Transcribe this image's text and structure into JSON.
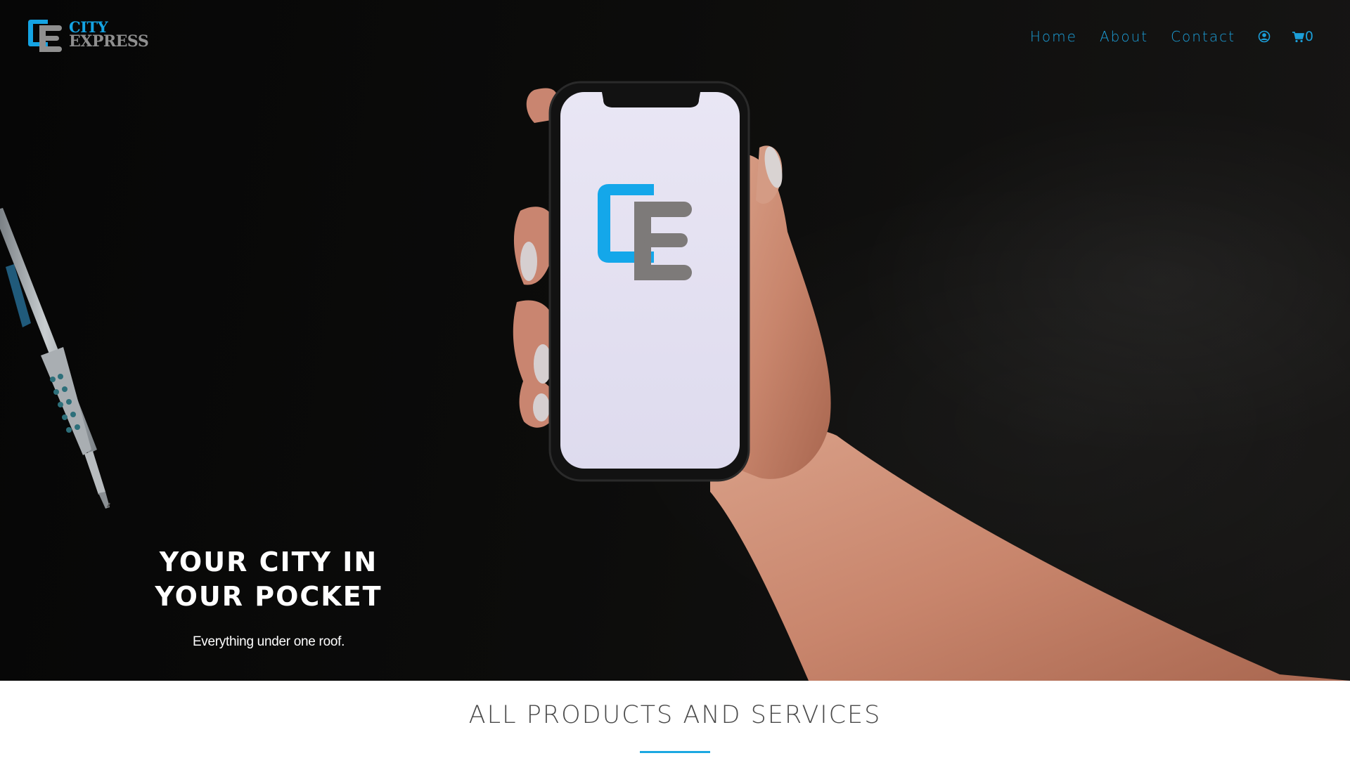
{
  "header": {
    "logo": {
      "line1": "CITY",
      "line2": "EXPRESS"
    },
    "nav": [
      {
        "label": "Home"
      },
      {
        "label": "About"
      },
      {
        "label": "Contact"
      }
    ],
    "account_icon": "user-circle-icon",
    "cart_icon": "shopping-cart-icon",
    "cart_count": "0"
  },
  "hero": {
    "title_line1": "YOUR CITY IN",
    "title_line2": "YOUR POCKET",
    "subtitle": "Everything under one roof."
  },
  "section": {
    "title": "ALL PRODUCTS AND SERVICES"
  },
  "colors": {
    "accent": "#1c9fd9",
    "logo_blue": "#14a3e3",
    "logo_gray": "#8f8f8f",
    "hero_bg": "#0b0b0a",
    "heading_text": "#4a4a4a"
  }
}
